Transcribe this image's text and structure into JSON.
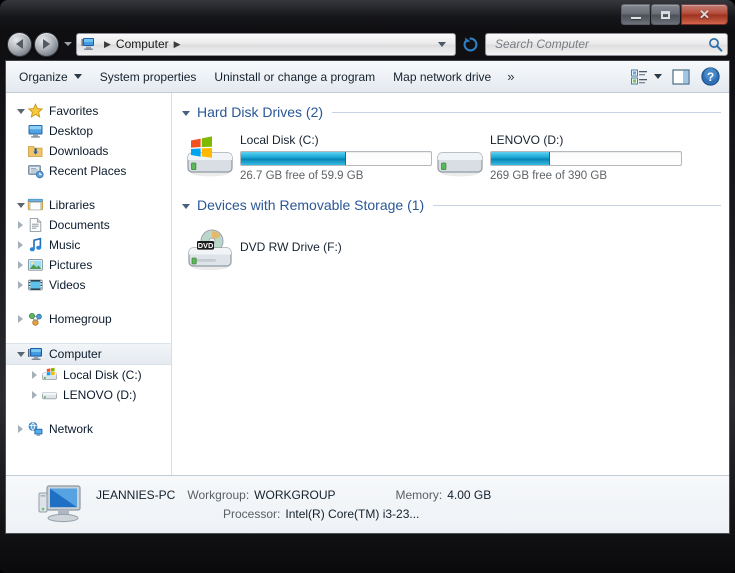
{
  "window": {
    "controls": {
      "minimize": "minimize-button",
      "maximize": "maximize-button",
      "close_label": "✕"
    }
  },
  "navbar": {
    "back_tooltip": "Back",
    "forward_tooltip": "Forward",
    "breadcrumb": {
      "root_icon": "computer-icon",
      "items": [
        "Computer"
      ],
      "separator": "▶"
    },
    "search": {
      "placeholder": "Search Computer",
      "value": ""
    }
  },
  "toolbar": {
    "organize_label": "Organize",
    "system_properties_label": "System properties",
    "uninstall_label": "Uninstall or change a program",
    "map_drive_label": "Map network drive",
    "overflow_label": "»",
    "view_icon": "view-options-icon",
    "preview_icon": "preview-pane-icon",
    "help_icon": "help-icon",
    "help_glyph": "?"
  },
  "navpane": {
    "groups": [
      {
        "name": "favorites",
        "label": "Favorites",
        "icon": "star-icon",
        "expanded": true,
        "children": [
          {
            "label": "Desktop",
            "icon": "desktop-icon"
          },
          {
            "label": "Downloads",
            "icon": "downloads-icon"
          },
          {
            "label": "Recent Places",
            "icon": "recent-places-icon"
          }
        ]
      },
      {
        "name": "libraries",
        "label": "Libraries",
        "icon": "libraries-icon",
        "expanded": true,
        "children": [
          {
            "label": "Documents",
            "icon": "documents-icon"
          },
          {
            "label": "Music",
            "icon": "music-icon"
          },
          {
            "label": "Pictures",
            "icon": "pictures-icon"
          },
          {
            "label": "Videos",
            "icon": "videos-icon"
          }
        ]
      },
      {
        "name": "homegroup",
        "label": "Homegroup",
        "icon": "homegroup-icon",
        "expanded": false,
        "children": []
      },
      {
        "name": "computer",
        "label": "Computer",
        "icon": "computer-icon",
        "expanded": true,
        "selected": true,
        "children": [
          {
            "label": "Local Disk (C:)",
            "icon": "hard-drive-windows-icon"
          },
          {
            "label": "LENOVO (D:)",
            "icon": "hard-drive-icon"
          }
        ]
      },
      {
        "name": "network",
        "label": "Network",
        "icon": "network-icon",
        "expanded": false,
        "children": []
      }
    ]
  },
  "content": {
    "groups": [
      {
        "name": "hard-disk-drives",
        "header": "Hard Disk Drives (2)",
        "items": [
          {
            "name": "local-disk-c",
            "title": "Local Disk (C:)",
            "icon": "hard-drive-windows-icon",
            "free_text": "26.7 GB free of 59.9 GB",
            "used_percent": 55
          },
          {
            "name": "lenovo-d",
            "title": "LENOVO (D:)",
            "icon": "hard-drive-icon",
            "free_text": "269 GB free of 390 GB",
            "used_percent": 31
          }
        ]
      },
      {
        "name": "removable-storage",
        "header": "Devices with Removable Storage (1)",
        "items": [
          {
            "name": "dvd-rw-drive-f",
            "title": "DVD RW Drive (F:)",
            "icon": "dvd-drive-icon",
            "badge": "DVD"
          }
        ]
      }
    ]
  },
  "details": {
    "computer_name": "JEANNIES-PC",
    "workgroup_key": "Workgroup:",
    "workgroup_value": "WORKGROUP",
    "memory_key": "Memory:",
    "memory_value": "4.00 GB",
    "processor_key": "Processor:",
    "processor_value": "Intel(R) Core(TM) i3-23...",
    "icon": "computer-monitor-icon"
  },
  "colors": {
    "accent_blue": "#2b5797",
    "bar_fill": "#17a9d6",
    "close_red": "#d5492f"
  }
}
